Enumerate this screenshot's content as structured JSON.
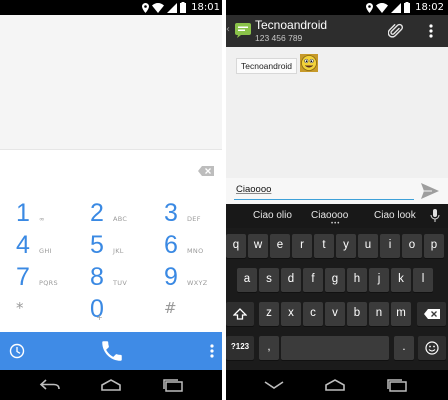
{
  "status_bar": {
    "left_time": "18:01",
    "right_time": "18:02",
    "icons": [
      "location-icon",
      "wifi-icon",
      "signal-icon",
      "battery-icon"
    ]
  },
  "dialer": {
    "keys": [
      {
        "digit": "1",
        "letters": "∞"
      },
      {
        "digit": "2",
        "letters": "ABC"
      },
      {
        "digit": "3",
        "letters": "DEF"
      },
      {
        "digit": "4",
        "letters": "GHI"
      },
      {
        "digit": "5",
        "letters": "JKL"
      },
      {
        "digit": "6",
        "letters": "MNO"
      },
      {
        "digit": "7",
        "letters": "PQRS"
      },
      {
        "digit": "8",
        "letters": "TUV"
      },
      {
        "digit": "9",
        "letters": "WXYZ"
      },
      {
        "digit": "*",
        "letters": ""
      },
      {
        "digit": "0",
        "letters": "+"
      },
      {
        "digit": "#",
        "letters": ""
      }
    ],
    "accent_color": "#3f8be6",
    "bottom_bar_icons": [
      "clock-icon",
      "phone-icon",
      "overflow-menu-icon"
    ]
  },
  "messaging": {
    "contact_name": "Tecnoandroid",
    "contact_number": "123 456 789",
    "message_text": "Tecnoandroid",
    "compose_text": "Ciaoooo",
    "action_icons": [
      "paperclip-icon",
      "overflow-menu-icon"
    ]
  },
  "keyboard": {
    "suggestions": [
      "Ciao olio",
      "Ciaoooo",
      "Ciao look"
    ],
    "row1": [
      "q",
      "w",
      "e",
      "r",
      "t",
      "y",
      "u",
      "i",
      "o",
      "p"
    ],
    "row2": [
      "a",
      "s",
      "d",
      "f",
      "g",
      "h",
      "j",
      "k",
      "l"
    ],
    "row3": [
      "z",
      "x",
      "c",
      "v",
      "b",
      "n",
      "m"
    ],
    "row4": {
      "symbols": "?123",
      "comma": ",",
      "period": "."
    }
  }
}
